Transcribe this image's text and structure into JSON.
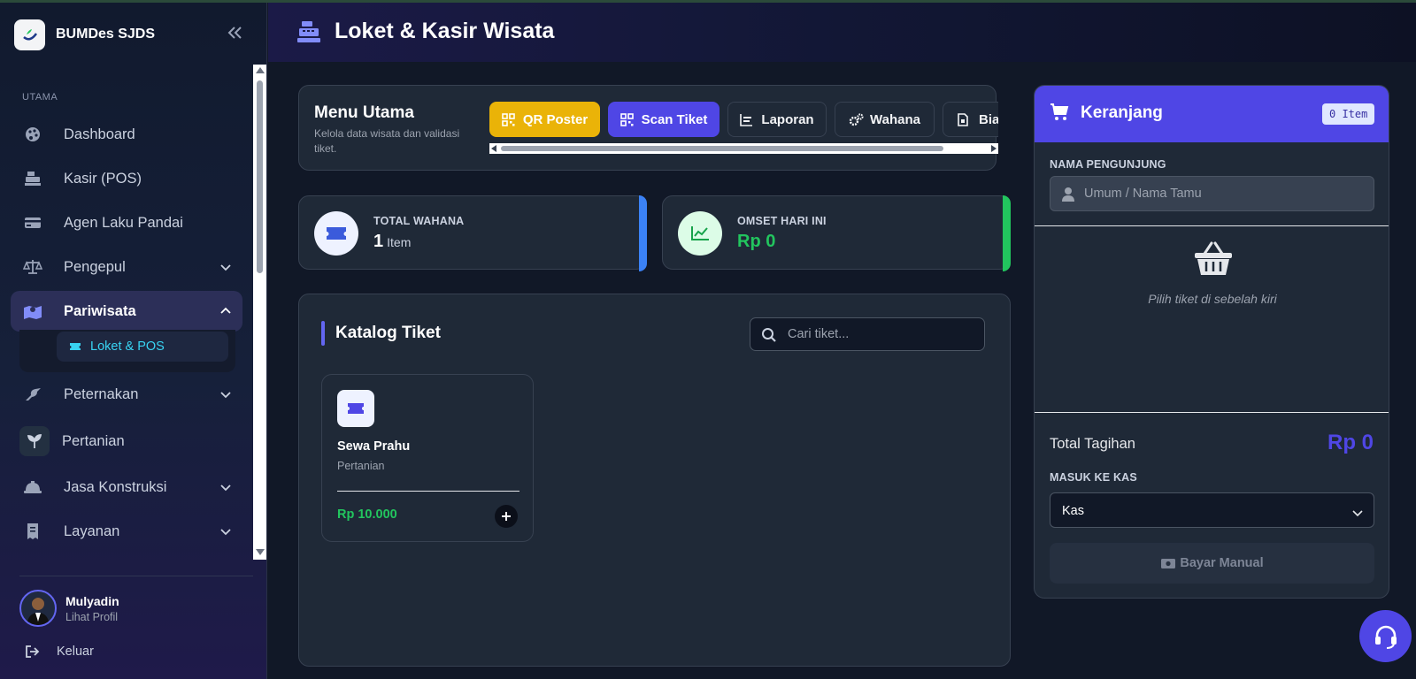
{
  "sidebar": {
    "brand": "BUMDes SJDS",
    "section_label": "UTAMA",
    "items": [
      {
        "label": "Dashboard"
      },
      {
        "label": "Kasir (POS)"
      },
      {
        "label": "Agen Laku Pandai"
      },
      {
        "label": "Pengepul"
      },
      {
        "label": "Pariwisata"
      },
      {
        "label": "Peternakan"
      },
      {
        "label": "Pertanian"
      },
      {
        "label": "Jasa Konstruksi"
      },
      {
        "label": "Layanan"
      }
    ],
    "submenu": {
      "label": "Loket & POS"
    },
    "user": {
      "name": "Mulyadin",
      "link": "Lihat Profil"
    },
    "logout": "Keluar"
  },
  "header": {
    "title": "Loket & Kasir Wisata"
  },
  "menu": {
    "title": "Menu Utama",
    "subtitle": "Kelola data wisata dan validasi tiket.",
    "tabs": [
      {
        "label": "QR Poster"
      },
      {
        "label": "Scan Tiket"
      },
      {
        "label": "Laporan"
      },
      {
        "label": "Wahana"
      },
      {
        "label": "Bia"
      }
    ]
  },
  "stats": [
    {
      "label": "TOTAL WAHANA",
      "value": "1",
      "unit": "Item",
      "accent": "#3b82f6"
    },
    {
      "label": "OMSET HARI INI",
      "value": "Rp 0",
      "unit": "",
      "accent": "#22c55e"
    }
  ],
  "catalog": {
    "title": "Katalog Tiket",
    "search_placeholder": "Cari tiket...",
    "tickets": [
      {
        "name": "Sewa Prahu",
        "category": "Pertanian",
        "price": "Rp 10.000"
      }
    ]
  },
  "cart": {
    "title": "Keranjang",
    "badge": "0 Item",
    "visitor_label": "NAMA PENGUNJUNG",
    "visitor_placeholder": "Umum / Nama Tamu",
    "empty_text": "Pilih tiket di sebelah kiri",
    "total_label": "Total Tagihan",
    "total_value": "Rp 0",
    "account_label": "MASUK KE KAS",
    "account_value": "Kas",
    "pay_label": "Bayar Manual"
  },
  "colors": {
    "accent": "#4f46e5",
    "yellow": "#eab308",
    "cyan": "#38d3f2",
    "green": "#22c55e"
  }
}
